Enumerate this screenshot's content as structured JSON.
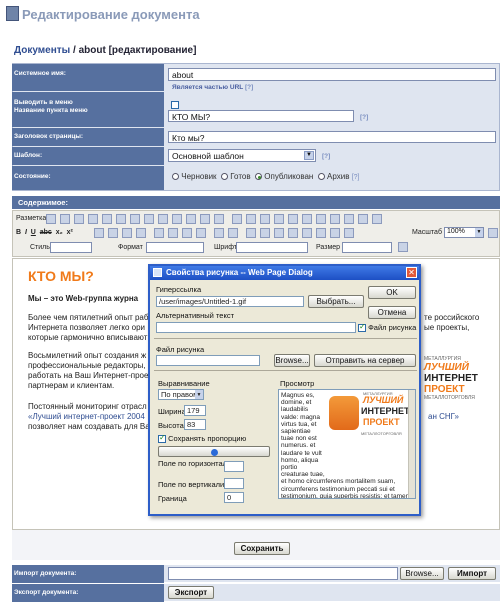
{
  "page": {
    "title": "Редактирование документа",
    "breadcrumb_link": "Документы",
    "breadcrumb_rest": " / about [редактирование]"
  },
  "form": {
    "system_name_label": "Системное имя:",
    "system_name_value": "about",
    "system_name_hint": "Является частью URL",
    "menu_label": "Выводить в меню",
    "menu_item_label": "Название пункта меню",
    "menu_item_value": "КТО МЫ?",
    "page_title_label": "Заголовок страницы:",
    "page_title_value": "Кто мы?",
    "template_label": "Шаблон:",
    "template_value": "Основной шаблон",
    "state_label": "Состояние:",
    "states": [
      "Черновик",
      "Готов",
      "Опубликован",
      "Архив"
    ],
    "help": "[?]"
  },
  "editor": {
    "section_label": "Содержимое:",
    "markup_label": "Разметка",
    "style_label": "Стиль",
    "format_label": "Формат",
    "font_label": "Шрифт",
    "size_label": "Размер",
    "zoom_label": "Масштаб",
    "zoom_value": "100%"
  },
  "content": {
    "heading": "КТО МЫ?",
    "p1": "Мы – это Web-группа журна",
    "p2a": "Более чем пятилетний опыт раб",
    "p2b": "Интернета позволяет легко ори",
    "p2c": "которые гармонично вписывают",
    "p2_right_a": "те российского",
    "p2_right_b": "ые проекты,",
    "p3a": "Восьмилетний опыт создания ж",
    "p3b": "профессиональные редакторы, ",
    "p3c": "работать на Ваш Интернет-прое",
    "p3d": "партнерам и клиентам.",
    "p4a": "Постоянный мониторинг отрасл",
    "p4b": "«Лучший интернет-проект 2004",
    "p4b_right": "ан СНГ»",
    "p4c": "позволяет нам создавать для Ва"
  },
  "dialog": {
    "title": "Свойства рисунка -- Web Page Dialog",
    "hyperlink_label": "Гиперссылка",
    "hyperlink_value": "/user/images/Untitled-1.gif",
    "choose_button": "Выбрать...",
    "alt_label": "Альтернативный текст",
    "ok_button": "OK",
    "cancel_button": "Отмена",
    "image_file_check": "Файл рисунка",
    "image_file_label": "Файл рисунка",
    "browse_button": "Browse...",
    "send_button": "Отправить на сервер",
    "align_label": "Выравнивание",
    "align_value": "По правом",
    "width_label": "Ширина",
    "width_value": "179",
    "height_label": "Высота",
    "height_value": "83",
    "keep_ratio": "Сохранять пропорцию",
    "hspace_label": "Поле по горизонтали",
    "vspace_label": "Поле по вертикали",
    "border_label": "Граница",
    "border_value": "0",
    "preview_label": "Просмотр",
    "preview_text": "Magnus es, domine, et laudabilis valde: magna virtus tua, et sapientiae tuae non est numerus. et laudare te vult homo, aliqua portio creaturae tuae, et homo circumferens mortalitem suam, circumferens testimonium peccati sui et testimonium, quia superbis resistis: et tamen laudare te vult homo, aliqua portio creaturae tuae.",
    "logo_top": "МЕТАЛЛУРГИЯ",
    "logo_l1": "ЛУЧШИЙ",
    "logo_l2": "ИНТЕРНЕТ",
    "logo_l3": "ПРОЕКТ",
    "logo_bottom": "МЕТАЛЛОТОРГОВЛЯ"
  },
  "side_logo": {
    "top": "МЕТАЛЛУРГИЯ",
    "l1": "ЛУЧШИЙ",
    "l2": "ИНТЕРНЕТ",
    "l3": "ПРОЕКТ",
    "bottom": "МЕТАЛЛОТОРГОВЛЯ"
  },
  "footer": {
    "save_button": "Сохранить",
    "import_label": "Импорт документа:",
    "browse_button": "Browse...",
    "import_button": "Импорт",
    "export_label": "Экспорт документа:",
    "export_button": "Экспорт"
  },
  "colors": {
    "accent": "#56709f",
    "link": "#2f4d91",
    "orange": "#f07a1a"
  }
}
